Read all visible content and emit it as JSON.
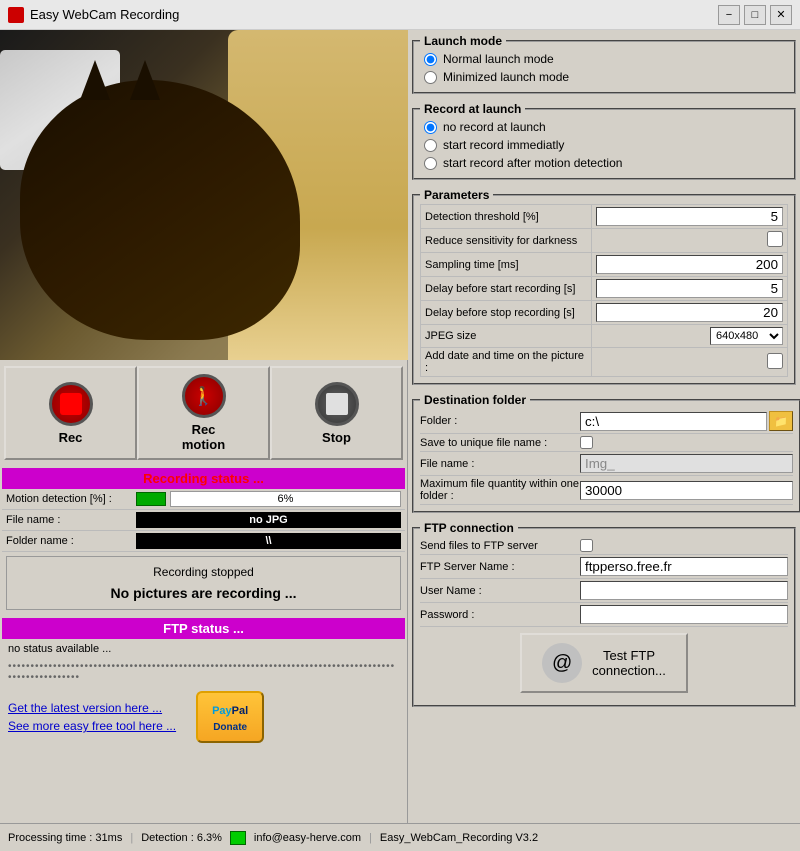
{
  "titleBar": {
    "title": "Easy WebCam Recording",
    "minimizeLabel": "−",
    "maximizeLabel": "□",
    "closeLabel": "✕"
  },
  "launchMode": {
    "groupTitle": "Launch mode",
    "options": [
      {
        "label": "Normal launch mode",
        "checked": true
      },
      {
        "label": "Minimized launch mode",
        "checked": false
      }
    ]
  },
  "recordAtLaunch": {
    "groupTitle": "Record at launch",
    "options": [
      {
        "label": "no record at launch",
        "checked": true
      },
      {
        "label": "start record immediatly",
        "checked": false
      },
      {
        "label": "start record after motion detection",
        "checked": false
      }
    ]
  },
  "parameters": {
    "groupTitle": "Parameters",
    "rows": [
      {
        "label": "Detection threshold [%]",
        "value": "5"
      },
      {
        "label": "Reduce sensitivity for darkness",
        "value": "",
        "type": "checkbox"
      },
      {
        "label": "Sampling time [ms]",
        "value": "200"
      },
      {
        "label": "Delay before start recording [s]",
        "value": "5"
      },
      {
        "label": "Delay before stop recording [s]",
        "value": "20"
      },
      {
        "label": "JPEG size",
        "value": "640x480",
        "type": "select"
      },
      {
        "label": "Add date and time on the picture :",
        "value": "",
        "type": "checkbox"
      }
    ]
  },
  "destinationFolder": {
    "groupTitle": "Destination folder",
    "rows": [
      {
        "label": "Folder :",
        "value": "c:\\",
        "type": "folder"
      },
      {
        "label": "Save to unique file name :",
        "value": "",
        "type": "checkbox"
      },
      {
        "label": "File name :",
        "value": "Img_",
        "disabled": true
      },
      {
        "label": "Maximum file quantity within one folder :",
        "value": "30000"
      }
    ]
  },
  "ftpConnection": {
    "groupTitle": "FTP connection",
    "rows": [
      {
        "label": "Send files to FTP server",
        "value": "",
        "type": "checkbox"
      },
      {
        "label": "FTP Server Name :",
        "value": "ftpperso.free.fr"
      },
      {
        "label": "User Name :",
        "value": ""
      },
      {
        "label": "Password :",
        "value": ""
      }
    ],
    "testButtonLabel": "Test FTP\nconnection..."
  },
  "controls": {
    "recLabel": "Rec",
    "recMotionLabel": "Rec\nmotion",
    "stopLabel": "Stop"
  },
  "recordingStatus": {
    "header": "Recording status ...",
    "motionLabel": "Motion detection [%] :",
    "motionValue": "6%",
    "fileNameLabel": "File name :",
    "fileNameValue": "no JPG",
    "folderNameLabel": "Folder name :",
    "folderNameValue": "\\\\",
    "stoppedTitle": "Recording stopped",
    "stoppedText": "No pictures are recording ..."
  },
  "ftpStatus": {
    "header": "FTP status ...",
    "statusText": "no status available ...",
    "dots": "••••••••••••••••••••••••••••••••••••••••••••••••••••••••••••••••••••••••••••••••••••••••••••••••••••••"
  },
  "bottomLinks": {
    "link1": "Get the latest version here ...",
    "link2": "See more easy free tool here ...",
    "paypalLabel": "PayPal\nDonate"
  },
  "statusBar": {
    "processingTime": "Processing time : 31ms",
    "detection": "Detection : 6.3%",
    "email": "info@easy-herve.com",
    "version": "Easy_WebCam_Recording V3.2"
  }
}
